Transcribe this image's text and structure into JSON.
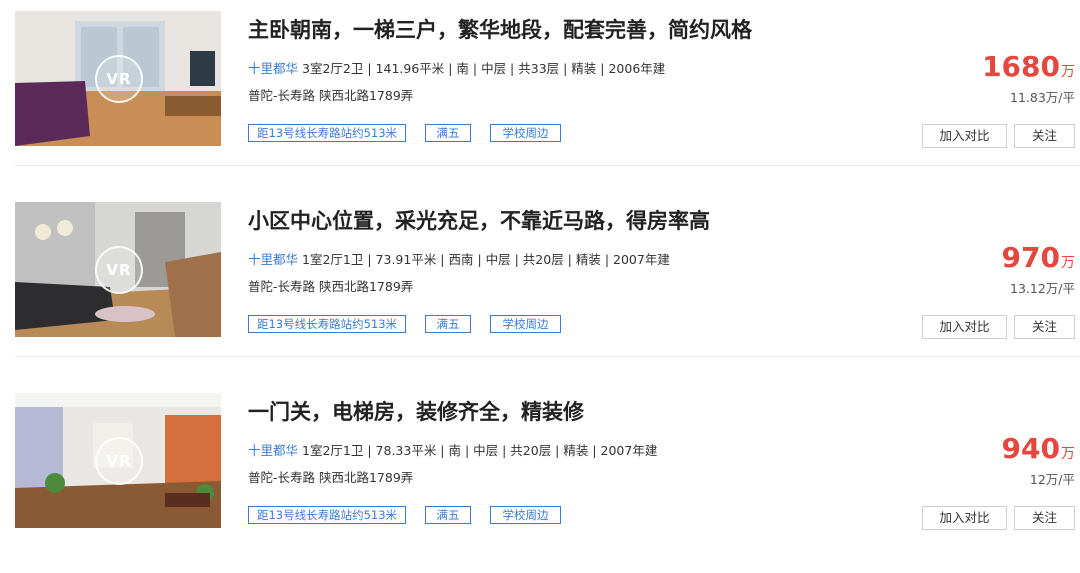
{
  "listings": [
    {
      "title": "主卧朝南，一梯三户，繁华地段，配套完善，简约风格",
      "community": "十里都华",
      "details": "3室2厅2卫 | 141.96平米 | 南 | 中层 | 共33层 | 精装 | 2006年建",
      "address": "普陀-长寿路 陕西北路1789弄",
      "tags": [
        "距13号线长寿路站约513米",
        "满五",
        "学校周边"
      ],
      "price": "1680",
      "price_unit": "万",
      "unit_price": "11.83万/平",
      "compare_label": "加入对比",
      "follow_label": "关注",
      "vr_label": "VR"
    },
    {
      "title": "小区中心位置，采光充足，不靠近马路，得房率高",
      "community": "十里都华",
      "details": "1室2厅1卫 | 73.91平米 | 西南 | 中层 | 共20层 | 精装 | 2007年建",
      "address": "普陀-长寿路 陕西北路1789弄",
      "tags": [
        "距13号线长寿路站约513米",
        "满五",
        "学校周边"
      ],
      "price": "970",
      "price_unit": "万",
      "unit_price": "13.12万/平",
      "compare_label": "加入对比",
      "follow_label": "关注",
      "vr_label": "VR"
    },
    {
      "title": "一门关，电梯房，装修齐全，精装修",
      "community": "十里都华",
      "details": "1室2厅1卫 | 78.33平米 | 南 | 中层 | 共20层 | 精装 | 2007年建",
      "address": "普陀-长寿路 陕西北路1789弄",
      "tags": [
        "距13号线长寿路站约513米",
        "满五",
        "学校周边"
      ],
      "price": "940",
      "price_unit": "万",
      "unit_price": "12万/平",
      "compare_label": "加入对比",
      "follow_label": "关注",
      "vr_label": "VR"
    }
  ],
  "colors": {
    "price": "#e2483d",
    "link": "#3a7bd5",
    "tag_border": "#3a7bd5"
  }
}
